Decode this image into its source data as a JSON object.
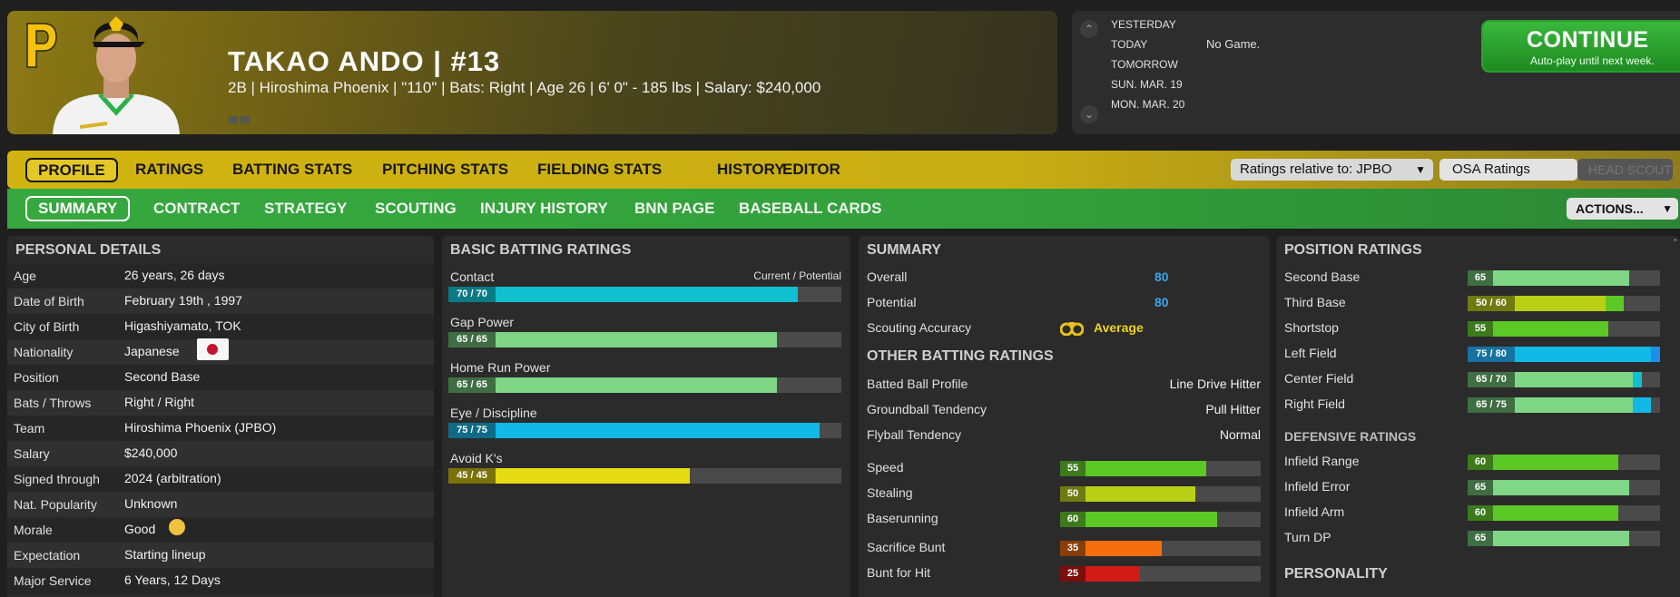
{
  "player": {
    "name_line": "TAKAO ANDO  |  #13",
    "sub_line": "2B | Hiroshima Phoenix  |  \"110\" | Bats: Right  |  Age 26  |  6' 0\" - 185 lbs  |  Salary: $240,000"
  },
  "schedule": {
    "days": [
      {
        "label": "YESTERDAY",
        "game": ""
      },
      {
        "label": "TODAY",
        "game": "No Game."
      },
      {
        "label": "TOMORROW",
        "game": ""
      },
      {
        "label": "SUN. MAR. 19",
        "game": ""
      },
      {
        "label": "MON. MAR. 20",
        "game": ""
      }
    ]
  },
  "continue_button": {
    "title": "CONTINUE",
    "subtitle": "Auto-play until next week."
  },
  "tabs_main": [
    "PROFILE",
    "RATINGS",
    "BATTING STATS",
    "PITCHING STATS",
    "FIELDING STATS",
    "HISTORY",
    "EDITOR"
  ],
  "tabs_sub": [
    "SUMMARY",
    "CONTRACT",
    "STRATEGY",
    "SCOUTING",
    "INJURY HISTORY",
    "BNN PAGE",
    "BASEBALL CARDS"
  ],
  "controls": {
    "ratings_relative": "Ratings relative to: JPBO",
    "osa_ratings": "OSA Ratings",
    "head_scout": "HEAD SCOUT",
    "actions": "ACTIONS..."
  },
  "colors": {
    "cyan": "#10c0d0",
    "light_green": "#7fd685",
    "blue": "#12b8e6",
    "yellow": "#e7db13",
    "green": "#5cc825",
    "lime": "#b9cf16",
    "orange": "#f56f0e",
    "red": "#d11b16"
  },
  "personal_details": {
    "title": "PERSONAL DETAILS",
    "rows": [
      {
        "label": "Age",
        "value": "26 years, 26 days"
      },
      {
        "label": "Date of Birth",
        "value": "February 19th , 1997"
      },
      {
        "label": "City of Birth",
        "value": "Higashiyamato, TOK"
      },
      {
        "label": "Nationality",
        "value": "Japanese"
      },
      {
        "label": "Position",
        "value": "Second Base"
      },
      {
        "label": "Bats / Throws",
        "value": "Right / Right"
      },
      {
        "label": "Team",
        "value": "Hiroshima Phoenix (JPBO)"
      },
      {
        "label": "Salary",
        "value": "$240,000"
      },
      {
        "label": "Signed through",
        "value": "2024 (arbitration)"
      },
      {
        "label": "Nat. Popularity",
        "value": "Unknown"
      },
      {
        "label": "Morale",
        "value": "Good"
      },
      {
        "label": "Expectation",
        "value": "Starting lineup"
      },
      {
        "label": "Major Service",
        "value": "6 Years, 12 Days"
      }
    ]
  },
  "basic_batting": {
    "title": "BASIC BATTING RATINGS",
    "legend": "Current / Potential",
    "items": [
      {
        "label": "Contact",
        "current": 70,
        "potential": 70,
        "badge": "70 / 70",
        "color": "#10c0d0"
      },
      {
        "label": "Gap Power",
        "current": 65,
        "potential": 65,
        "badge": "65 / 65",
        "color": "#7fd685"
      },
      {
        "label": "Home Run Power",
        "current": 65,
        "potential": 65,
        "badge": "65 / 65",
        "color": "#7fd685"
      },
      {
        "label": "Eye / Discipline",
        "current": 75,
        "potential": 75,
        "badge": "75 / 75",
        "color": "#12b8e6"
      },
      {
        "label": "Avoid K's",
        "current": 45,
        "potential": 45,
        "badge": "45 / 45",
        "color": "#e7db13"
      }
    ]
  },
  "summary": {
    "title": "SUMMARY",
    "overall_label": "Overall",
    "overall": "80",
    "potential_label": "Potential",
    "potential": "80",
    "scouting_label": "Scouting Accuracy",
    "scouting": "Average"
  },
  "other_batting": {
    "title": "OTHER BATTING RATINGS",
    "rows": [
      {
        "label": "Batted Ball Profile",
        "value": "Line Drive Hitter"
      },
      {
        "label": "Groundball Tendency",
        "value": "Pull Hitter"
      },
      {
        "label": "Flyball Tendency",
        "value": "Normal"
      }
    ],
    "bars": [
      {
        "label": "Speed",
        "value": 55,
        "badge": "55",
        "color": "#5cc825",
        "badge_bg": "#3c7a1c"
      },
      {
        "label": "Stealing",
        "value": 50,
        "badge": "50",
        "color": "#b9cf16",
        "badge_bg": "#6f7a10"
      },
      {
        "label": "Baserunning",
        "value": 60,
        "badge": "60",
        "color": "#5cc825",
        "badge_bg": "#3c7a1c"
      },
      {
        "label": "Sacrifice Bunt",
        "value": 35,
        "badge": "35",
        "color": "#f56f0e",
        "badge_bg": "#8a3d08"
      },
      {
        "label": "Bunt for Hit",
        "value": 25,
        "badge": "25",
        "color": "#d11b16",
        "badge_bg": "#7a0e0b"
      }
    ]
  },
  "position_ratings": {
    "title": "POSITION RATINGS",
    "items": [
      {
        "label": "Second Base",
        "current": 65,
        "potential": 65,
        "badge": "65",
        "color": "#7fd685",
        "badge_bg": "#3f6e43"
      },
      {
        "label": "Third Base",
        "current": 50,
        "potential": 60,
        "badge": "50 / 60",
        "color": "#b9cf16",
        "pot_color": "#5cc825",
        "badge_bg": "#6f7a10"
      },
      {
        "label": "Shortstop",
        "current": 55,
        "potential": 55,
        "badge": "55",
        "color": "#5cc825",
        "badge_bg": "#3c7a1c"
      },
      {
        "label": "Left Field",
        "current": 75,
        "potential": 80,
        "badge": "75 / 80",
        "color": "#12b8e6",
        "pot_color": "#1a90e8",
        "badge_bg": "#1672a0"
      },
      {
        "label": "Center Field",
        "current": 65,
        "potential": 70,
        "badge": "65 / 70",
        "color": "#7fd685",
        "pot_color": "#10c0d0",
        "badge_bg": "#3f6e43"
      },
      {
        "label": "Right Field",
        "current": 65,
        "potential": 75,
        "badge": "65 / 75",
        "color": "#7fd685",
        "pot_color": "#12b8e6",
        "badge_bg": "#3f6e43"
      }
    ]
  },
  "defensive_ratings": {
    "title": "DEFENSIVE RATINGS",
    "items": [
      {
        "label": "Infield Range",
        "value": 60,
        "badge": "60",
        "color": "#5cc825",
        "badge_bg": "#3c7a1c"
      },
      {
        "label": "Infield Error",
        "value": 65,
        "badge": "65",
        "color": "#7fd685",
        "badge_bg": "#3f6e43"
      },
      {
        "label": "Infield Arm",
        "value": 60,
        "badge": "60",
        "color": "#5cc825",
        "badge_bg": "#3c7a1c"
      },
      {
        "label": "Turn DP",
        "value": 65,
        "badge": "65",
        "color": "#7fd685",
        "badge_bg": "#3f6e43"
      }
    ]
  },
  "personality": {
    "title": "PERSONALITY"
  }
}
